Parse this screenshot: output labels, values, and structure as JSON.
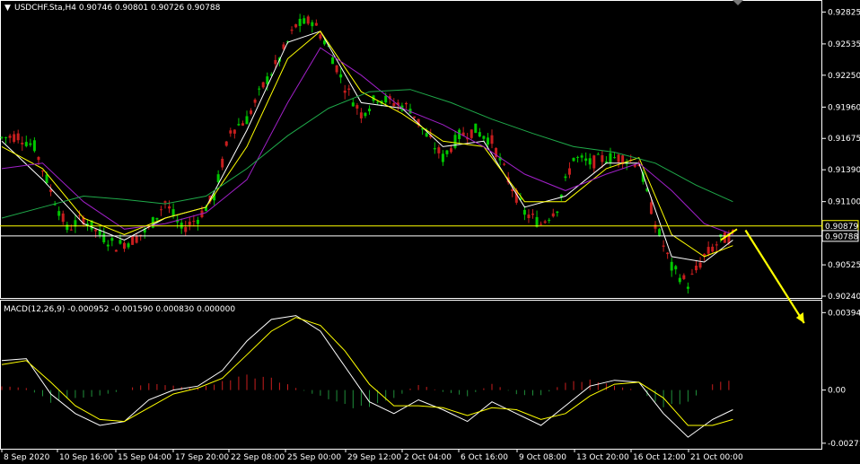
{
  "colors": {
    "background": "#000000",
    "frame": "#ffffff",
    "bull_candle": "#00c800",
    "bear_candle": "#c81e1e",
    "ma_fast": "#ffffff",
    "ma_mid": "#ffff00",
    "ma_slow": "#a020c8",
    "ma_long": "#1faa4a",
    "price_line": "#ffff00",
    "macd_main": "#ffffff",
    "macd_signal": "#ffff00",
    "hist_pos": "#c81e1e",
    "hist_neg": "#1f8f3a",
    "arrow": "#ffff00"
  },
  "header": {
    "symbol_info": "USDCHF.Sta,H4  0.90746 0.90801 0.90726 0.90788",
    "dropdown_icon": "triangle-down-icon"
  },
  "macd_header": {
    "text": "MACD(12,26,9) -0.000952 -0.001590 0.000830 0.000000"
  },
  "chart_data": [
    {
      "type": "candlestick",
      "title": "USDCHF.Sta,H4",
      "ylim": [
        0.9024,
        0.9282
      ],
      "y_ticks": [
        "0.92825",
        "0.92535",
        "0.92250",
        "0.91960",
        "0.91675",
        "0.91390",
        "0.91100",
        "0.90525",
        "0.90240"
      ],
      "highlight_labels": [
        {
          "label": "0.90879",
          "value": 0.90879,
          "style": "boxed-yellow"
        },
        {
          "label": "0.90788",
          "value": 0.90788,
          "style": "boxed-white"
        }
      ],
      "x_ticks": [
        "8 Sep 2020",
        "10 Sep 16:00",
        "15 Sep 04:00",
        "17 Sep 20:00",
        "22 Sep 08:00",
        "25 Sep 00:00",
        "29 Sep 12:00",
        "2 Oct 04:00",
        "6 Oct 16:00",
        "9 Oct 08:00",
        "13 Oct 20:00",
        "16 Oct 12:00",
        "21 Oct 00:00"
      ],
      "price_path": [
        [
          0,
          0.9168
        ],
        [
          4,
          0.917
        ],
        [
          8,
          0.916
        ],
        [
          12,
          0.912
        ],
        [
          16,
          0.9085
        ],
        [
          20,
          0.9095
        ],
        [
          24,
          0.908
        ],
        [
          28,
          0.907
        ],
        [
          32,
          0.9075
        ],
        [
          36,
          0.9085
        ],
        [
          40,
          0.911
        ],
        [
          44,
          0.9085
        ],
        [
          48,
          0.9095
        ],
        [
          52,
          0.9115
        ],
        [
          56,
          0.9175
        ],
        [
          60,
          0.9185
        ],
        [
          64,
          0.9215
        ],
        [
          68,
          0.924
        ],
        [
          72,
          0.927
        ],
        [
          76,
          0.9275
        ],
        [
          80,
          0.925
        ],
        [
          84,
          0.9215
        ],
        [
          88,
          0.919
        ],
        [
          92,
          0.9205
        ],
        [
          96,
          0.92
        ],
        [
          100,
          0.9195
        ],
        [
          104,
          0.917
        ],
        [
          108,
          0.915
        ],
        [
          112,
          0.917
        ],
        [
          116,
          0.9175
        ],
        [
          120,
          0.9165
        ],
        [
          124,
          0.913
        ],
        [
          128,
          0.91
        ],
        [
          132,
          0.909
        ],
        [
          136,
          0.9105
        ],
        [
          140,
          0.915
        ],
        [
          144,
          0.9145
        ],
        [
          148,
          0.915
        ],
        [
          152,
          0.915
        ],
        [
          156,
          0.9145
        ],
        [
          160,
          0.909
        ],
        [
          164,
          0.905
        ],
        [
          168,
          0.9035
        ],
        [
          172,
          0.906
        ],
        [
          176,
          0.9075
        ],
        [
          179,
          0.9079
        ]
      ],
      "series": [
        {
          "name": "",
          "color_key": "ma_fast",
          "values": [
            [
              0,
              0.9165
            ],
            [
              10,
              0.913
            ],
            [
              20,
              0.909
            ],
            [
              30,
              0.9075
            ],
            [
              40,
              0.9095
            ],
            [
              50,
              0.9105
            ],
            [
              60,
              0.9175
            ],
            [
              70,
              0.9255
            ],
            [
              78,
              0.9265
            ],
            [
              88,
              0.92
            ],
            [
              98,
              0.9195
            ],
            [
              108,
              0.916
            ],
            [
              118,
              0.9165
            ],
            [
              128,
              0.9105
            ],
            [
              138,
              0.9115
            ],
            [
              148,
              0.9145
            ],
            [
              156,
              0.9145
            ],
            [
              164,
              0.906
            ],
            [
              172,
              0.9055
            ],
            [
              179,
              0.9075
            ]
          ]
        },
        {
          "name": "",
          "color_key": "ma_mid",
          "values": [
            [
              0,
              0.916
            ],
            [
              10,
              0.914
            ],
            [
              20,
              0.9095
            ],
            [
              30,
              0.908
            ],
            [
              40,
              0.9095
            ],
            [
              50,
              0.9105
            ],
            [
              60,
              0.916
            ],
            [
              70,
              0.924
            ],
            [
              78,
              0.9265
            ],
            [
              88,
              0.921
            ],
            [
              98,
              0.919
            ],
            [
              108,
              0.9165
            ],
            [
              118,
              0.916
            ],
            [
              128,
              0.911
            ],
            [
              138,
              0.911
            ],
            [
              148,
              0.914
            ],
            [
              156,
              0.915
            ],
            [
              164,
              0.908
            ],
            [
              172,
              0.906
            ],
            [
              179,
              0.907
            ]
          ]
        },
        {
          "name": "",
          "color_key": "ma_slow",
          "values": [
            [
              0,
              0.914
            ],
            [
              10,
              0.9145
            ],
            [
              20,
              0.911
            ],
            [
              30,
              0.9085
            ],
            [
              40,
              0.909
            ],
            [
              50,
              0.91
            ],
            [
              60,
              0.913
            ],
            [
              70,
              0.92
            ],
            [
              78,
              0.925
            ],
            [
              88,
              0.9225
            ],
            [
              98,
              0.9195
            ],
            [
              108,
              0.918
            ],
            [
              118,
              0.916
            ],
            [
              128,
              0.9135
            ],
            [
              138,
              0.912
            ],
            [
              148,
              0.9135
            ],
            [
              156,
              0.9145
            ],
            [
              164,
              0.912
            ],
            [
              172,
              0.909
            ],
            [
              179,
              0.908
            ]
          ]
        },
        {
          "name": "",
          "color_key": "ma_long",
          "values": [
            [
              0,
              0.9095
            ],
            [
              10,
              0.9105
            ],
            [
              20,
              0.9115
            ],
            [
              30,
              0.9112
            ],
            [
              40,
              0.9108
            ],
            [
              50,
              0.9115
            ],
            [
              60,
              0.914
            ],
            [
              70,
              0.917
            ],
            [
              80,
              0.9195
            ],
            [
              90,
              0.921
            ],
            [
              100,
              0.9212
            ],
            [
              110,
              0.92
            ],
            [
              120,
              0.9185
            ],
            [
              130,
              0.9172
            ],
            [
              140,
              0.916
            ],
            [
              150,
              0.9155
            ],
            [
              160,
              0.9145
            ],
            [
              170,
              0.9125
            ],
            [
              179,
              0.911
            ]
          ]
        }
      ],
      "projection_arrow": {
        "from": [
          179,
          0.9084
        ],
        "to": [
          196,
          0.9024
        ]
      }
    },
    {
      "type": "macd",
      "title": "MACD(12,26,9)",
      "ylim": [
        -0.0029,
        0.0041
      ],
      "y_ticks": [
        "0.003948",
        "0.00",
        "-0.00271"
      ],
      "main_line": [
        [
          0,
          0.0015
        ],
        [
          6,
          0.0016
        ],
        [
          12,
          -0.0002
        ],
        [
          18,
          -0.0012
        ],
        [
          24,
          -0.0018
        ],
        [
          30,
          -0.0016
        ],
        [
          36,
          -0.0005
        ],
        [
          42,
          0.0
        ],
        [
          48,
          0.0002
        ],
        [
          54,
          0.001
        ],
        [
          60,
          0.0025
        ],
        [
          66,
          0.0036
        ],
        [
          72,
          0.0038
        ],
        [
          78,
          0.003
        ],
        [
          84,
          0.0012
        ],
        [
          90,
          -0.0006
        ],
        [
          96,
          -0.0012
        ],
        [
          102,
          -0.0005
        ],
        [
          108,
          -0.001
        ],
        [
          114,
          -0.0016
        ],
        [
          120,
          -0.0006
        ],
        [
          126,
          -0.0012
        ],
        [
          132,
          -0.0018
        ],
        [
          138,
          -0.0008
        ],
        [
          144,
          0.0002
        ],
        [
          150,
          0.0005
        ],
        [
          156,
          0.0004
        ],
        [
          162,
          -0.0012
        ],
        [
          168,
          -0.0024
        ],
        [
          174,
          -0.0015
        ],
        [
          179,
          -0.001
        ]
      ],
      "signal_line": [
        [
          0,
          0.0013
        ],
        [
          6,
          0.0015
        ],
        [
          12,
          0.0004
        ],
        [
          18,
          -0.0008
        ],
        [
          24,
          -0.0015
        ],
        [
          30,
          -0.0016
        ],
        [
          36,
          -0.0009
        ],
        [
          42,
          -0.0002
        ],
        [
          48,
          0.0001
        ],
        [
          54,
          0.0006
        ],
        [
          60,
          0.0018
        ],
        [
          66,
          0.003
        ],
        [
          72,
          0.0037
        ],
        [
          78,
          0.0033
        ],
        [
          84,
          0.002
        ],
        [
          90,
          0.0003
        ],
        [
          96,
          -0.0008
        ],
        [
          102,
          -0.0008
        ],
        [
          108,
          -0.0009
        ],
        [
          114,
          -0.0013
        ],
        [
          120,
          -0.0009
        ],
        [
          126,
          -0.001
        ],
        [
          132,
          -0.0015
        ],
        [
          138,
          -0.0012
        ],
        [
          144,
          -0.0003
        ],
        [
          150,
          0.0003
        ],
        [
          156,
          0.0004
        ],
        [
          162,
          -0.0004
        ],
        [
          168,
          -0.0018
        ],
        [
          174,
          -0.0018
        ],
        [
          179,
          -0.0015
        ]
      ],
      "histogram": [
        [
          0,
          0.0002
        ],
        [
          6,
          0.0001
        ],
        [
          12,
          -0.0006
        ],
        [
          18,
          -0.0004
        ],
        [
          24,
          -0.0003
        ],
        [
          30,
          0.0
        ],
        [
          36,
          0.0004
        ],
        [
          42,
          0.0002
        ],
        [
          48,
          0.0001
        ],
        [
          54,
          0.0004
        ],
        [
          60,
          0.0007
        ],
        [
          66,
          0.0006
        ],
        [
          72,
          0.0001
        ],
        [
          78,
          -0.0003
        ],
        [
          84,
          -0.0008
        ],
        [
          90,
          -0.0009
        ],
        [
          96,
          -0.0004
        ],
        [
          102,
          0.0003
        ],
        [
          108,
          -0.0001
        ],
        [
          114,
          -0.0003
        ],
        [
          120,
          0.0003
        ],
        [
          126,
          -0.0002
        ],
        [
          132,
          -0.0003
        ],
        [
          138,
          0.0004
        ],
        [
          144,
          0.0005
        ],
        [
          150,
          0.0002
        ],
        [
          156,
          0.0
        ],
        [
          162,
          -0.0008
        ],
        [
          168,
          -0.0006
        ],
        [
          174,
          0.0003
        ],
        [
          179,
          0.0005
        ]
      ]
    }
  ]
}
